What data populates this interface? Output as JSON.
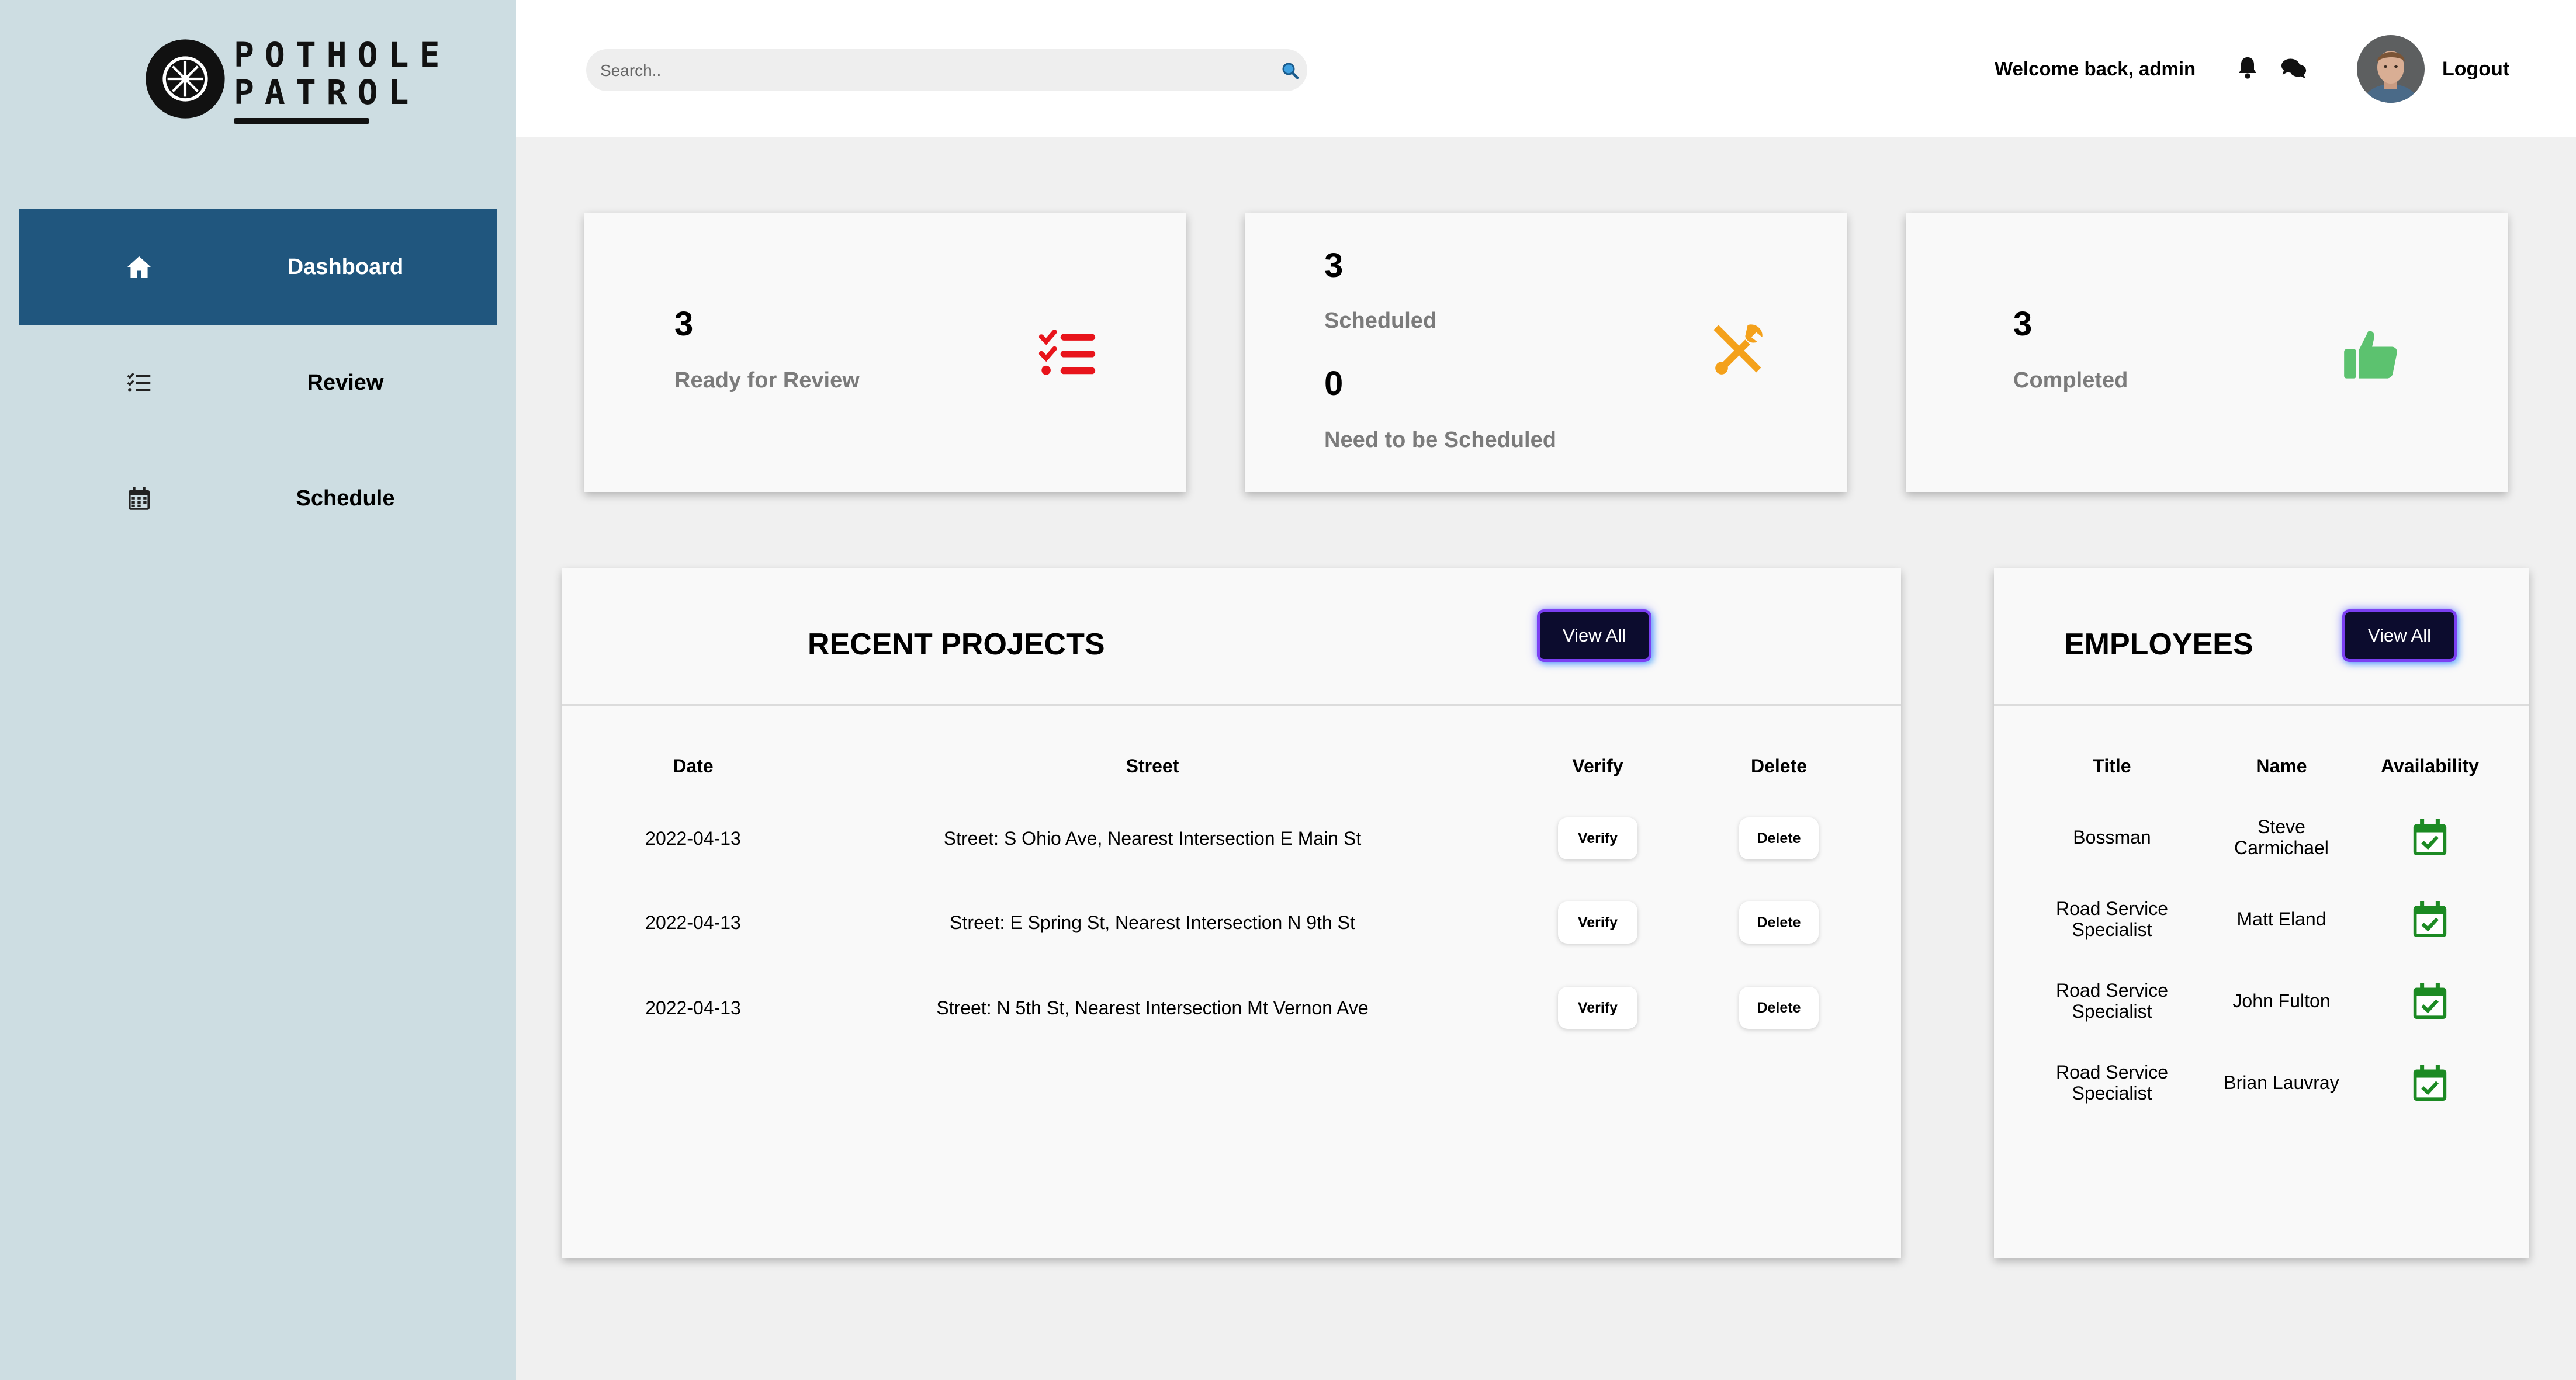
{
  "brand": {
    "logo_line1": "POTHOLE",
    "logo_line2": "PATROL"
  },
  "sidebar": {
    "items": [
      {
        "label": "Dashboard",
        "icon": "home-icon",
        "active": true
      },
      {
        "label": "Review",
        "icon": "checklist-icon",
        "active": false
      },
      {
        "label": "Schedule",
        "icon": "calendar-icon",
        "active": false
      }
    ]
  },
  "header": {
    "search_placeholder": "Search..",
    "welcome_text": "Welcome back, admin",
    "logout_label": "Logout"
  },
  "stats": {
    "review": {
      "value": "3",
      "label": "Ready for Review",
      "icon": "checklist-icon",
      "color": "#e8141b"
    },
    "scheduled": {
      "value": "3",
      "label": "Scheduled",
      "icon": "tools-icon",
      "color": "#f4a11b"
    },
    "unscheduled": {
      "value": "0",
      "label": "Need to be Scheduled"
    },
    "completed": {
      "value": "3",
      "label": "Completed",
      "icon": "thumbs-up-icon",
      "color": "#5cc26f"
    }
  },
  "projects": {
    "title": "RECENT PROJECTS",
    "view_all_label": "View All",
    "columns": [
      "Date",
      "Street",
      "Verify",
      "Delete"
    ],
    "rows": [
      {
        "date": "2022-04-13",
        "street": "Street: S Ohio Ave, Nearest Intersection E Main St",
        "verify": "Verify",
        "delete": "Delete"
      },
      {
        "date": "2022-04-13",
        "street": "Street: E Spring St, Nearest Intersection N 9th St",
        "verify": "Verify",
        "delete": "Delete"
      },
      {
        "date": "2022-04-13",
        "street": "Street: N 5th St, Nearest Intersection Mt Vernon Ave",
        "verify": "Verify",
        "delete": "Delete"
      }
    ]
  },
  "employees": {
    "title": "EMPLOYEES",
    "view_all_label": "View All",
    "columns": [
      "Title",
      "Name",
      "Availability"
    ],
    "rows": [
      {
        "title": "Bossman",
        "name": "Steve Carmichael",
        "availability": "calendar-check-icon"
      },
      {
        "title": "Road Service Specialist",
        "name": "Matt Eland",
        "availability": "calendar-check-icon"
      },
      {
        "title": "Road Service Specialist",
        "name": "John Fulton",
        "availability": "calendar-check-icon"
      },
      {
        "title": "Road Service Specialist",
        "name": "Brian Lauvray",
        "availability": "calendar-check-icon"
      }
    ]
  },
  "colors": {
    "sidebar_bg": "#cddde2",
    "nav_active": "#20567e",
    "available_green": "#1c8a23",
    "button_dark": "#0c0c2e"
  }
}
